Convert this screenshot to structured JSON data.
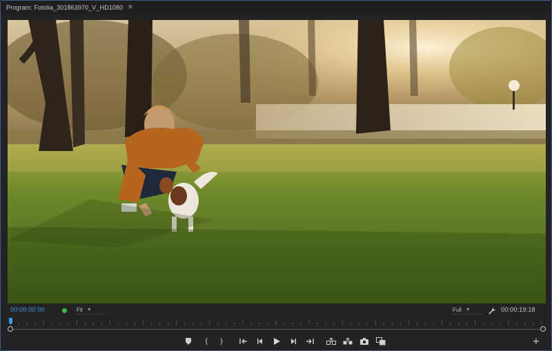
{
  "panel": {
    "title": "Program: Fotolia_301863970_V_HD1080",
    "menu_icon": "hamburger-icon"
  },
  "viewer": {
    "content": "video-frame"
  },
  "timecode": {
    "current": "00:00:00:00",
    "duration": "00:00:19:18",
    "zoom_value": "Fit",
    "resolution_value": "Full",
    "status_color": "#2fbf3f",
    "accent_color": "#3f9bf0"
  },
  "playback": {
    "position_fraction": 0.0
  },
  "controls": {
    "icons": [
      "add-marker-icon",
      "mark-in-icon",
      "mark-out-icon",
      "go-to-in-icon",
      "step-back-icon",
      "play-icon",
      "step-forward-icon",
      "go-to-out-icon",
      "lift-icon",
      "extract-icon",
      "export-frame-icon",
      "comparison-view-icon",
      "button-editor-icon"
    ],
    "mark_in_label": "{",
    "mark_out_label": "}",
    "add_label": "+"
  }
}
